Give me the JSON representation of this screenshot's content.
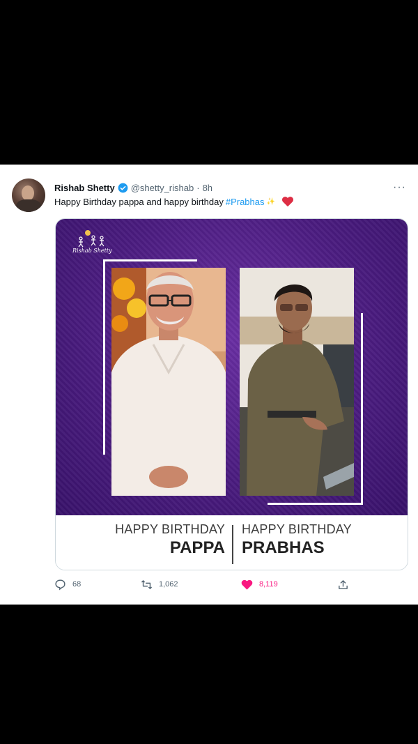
{
  "tweet": {
    "author_name": "Rishab Shetty",
    "handle": "@shetty_rishab",
    "separator": "·",
    "time": "8h",
    "more": "···",
    "text_before": "Happy Birthday pappa and happy birthday",
    "hashtag": "#Prabhas",
    "hashtag_emoji": "✨"
  },
  "media": {
    "logo_text": "Rishab Shetty",
    "left_caption_top": "HAPPY BIRTHDAY",
    "left_caption_big": "PAPPA",
    "right_caption_top": "HAPPY BIRTHDAY",
    "right_caption_big": "PRABHAS"
  },
  "actions": {
    "replies": "68",
    "retweets": "1,062",
    "likes": "8,119"
  },
  "colors": {
    "link": "#1d9bf0",
    "like": "#f91880",
    "banner_purple": "#4b1c80"
  }
}
